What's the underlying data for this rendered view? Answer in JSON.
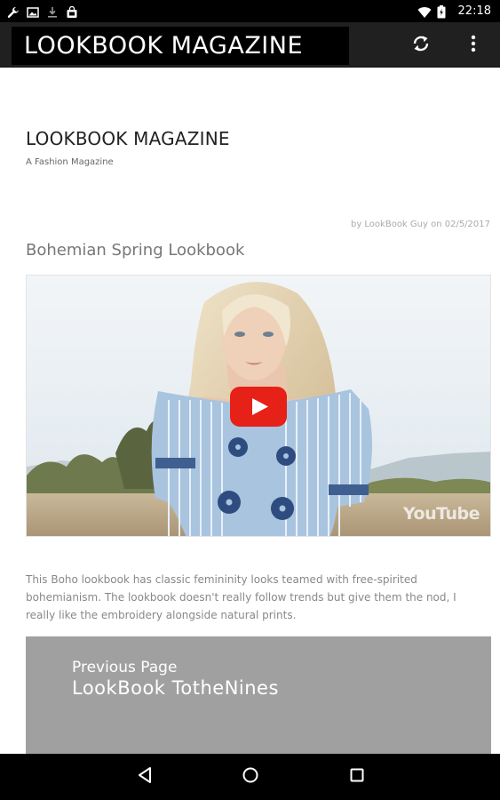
{
  "status_bar": {
    "time": "22:18",
    "icons": [
      "wrench-icon",
      "image-icon",
      "download-icon",
      "store-icon",
      "wifi-icon",
      "battery-icon"
    ]
  },
  "app_bar": {
    "title": "LOOKBOOK MAGAZINE",
    "actions": [
      "refresh-icon",
      "overflow-menu-icon"
    ]
  },
  "site": {
    "title": "LOOKBOOK MAGAZINE",
    "tagline": "A Fashion Magazine"
  },
  "post": {
    "meta": "by LookBook Guy on 02/5/2017",
    "title": "Bohemian Spring Lookbook",
    "video_watermark": "YouTube",
    "excerpt": "This Boho lookbook has classic femininity looks teamed with free-spirited bohemianism. The lookbook doesn't really follow trends but give them the nod, I really like the embroidery alongside natural prints."
  },
  "pagination": {
    "label": "Previous Page",
    "title": "LookBook TotheNines"
  },
  "nav_bar": {
    "buttons": [
      "back-icon",
      "home-icon",
      "recents-icon"
    ]
  },
  "colors": {
    "app_bar": "#202020",
    "status_bar": "#000000",
    "play_button": "#e62117",
    "prev_panel": "#a0a0a0"
  }
}
